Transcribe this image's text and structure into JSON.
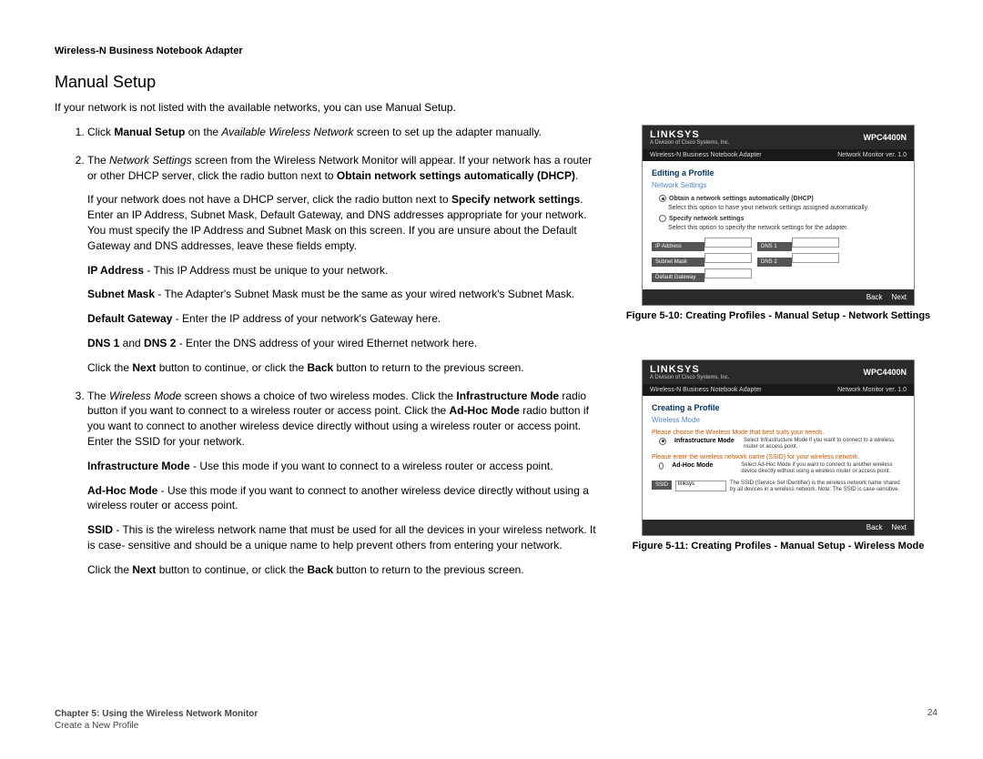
{
  "header": "Wireless-N Business Notebook Adapter",
  "title": "Manual Setup",
  "intro": "If your network is not listed with the available networks, you can use Manual Setup.",
  "steps": {
    "s1_a": "Click ",
    "s1_b": "Manual Setup",
    "s1_c": " on the ",
    "s1_d": "Available Wireless Network",
    "s1_e": " screen to set up the adapter manually.",
    "s2_a": "The ",
    "s2_b": "Network Settings",
    "s2_c": " screen from the Wireless Network Monitor will appear. If your network has a router or other DHCP server, click the radio button next to ",
    "s2_d": "Obtain network settings automatically (DHCP)",
    "s2_e": ".",
    "s2p2_a": "If your network does not have a DHCP server, click the radio button next to ",
    "s2p2_b": "Specify network settings",
    "s2p2_c": ". Enter an IP Address, Subnet Mask, Default Gateway, and DNS addresses appropriate for your network. You must specify the IP Address and Subnet Mask on this screen. If you are unsure about the Default Gateway and DNS addresses, leave these fields empty.",
    "ip_a": "IP Address",
    "ip_b": " - This IP Address must be unique to your network.",
    "sm_a": "Subnet Mask",
    "sm_b": " - The Adapter's Subnet Mask must be the same as your wired network's Subnet Mask.",
    "dg_a": "Default Gateway",
    "dg_b": " - Enter the IP address of your network's Gateway here.",
    "dns_a": "DNS 1",
    "dns_b": " and ",
    "dns_c": "DNS 2",
    "dns_d": " - Enter the DNS address of your wired Ethernet network here.",
    "nav_a": "Click the ",
    "nav_b": "Next",
    "nav_c": " button to continue, or click the ",
    "nav_d": "Back",
    "nav_e": " button to return to the previous screen.",
    "s3_a": "The ",
    "s3_b": "Wireless Mode",
    "s3_c": " screen shows a choice of two wireless modes. Click the ",
    "s3_d": "Infrastructure Mode",
    "s3_e": " radio button if you want to connect to a wireless router or access point. Click the ",
    "s3_f": "Ad-Hoc Mode",
    "s3_g": " radio button if you want to connect to another wireless device directly without using a wireless router or access point. Enter the SSID for your network.",
    "im_a": "Infrastructure Mode",
    "im_b": " - Use this mode if you want to connect to a wireless router or access point.",
    "ah_a": "Ad-Hoc Mode",
    "ah_b": " - Use this mode if you want to connect to another wireless device directly without using a wireless router or access point.",
    "ssid_a": "SSID",
    "ssid_b": " - This is the wireless network name that must be used for all the devices in your wireless network. It is case- sensitive and should be a unique name to help prevent others from entering your network."
  },
  "fig1": {
    "brand": "LINKSYS",
    "brandSub": "A Division of Cisco Systems, Inc.",
    "model": "WPC4400N",
    "barLeft": "Wireless-N Business Notebook Adapter",
    "barRight": "Network Monitor ver. 1.0",
    "h1": "Editing a Profile",
    "h2": "Network Settings",
    "opt1": "Obtain a network settings automatically (DHCP)",
    "opt1desc": "Select this option to have your network settings assigned automatically.",
    "opt2": "Specify network settings",
    "opt2desc": "Select this option to specify the network settings for the adapter.",
    "f1": "IP Address",
    "f2": "Subnet Mask",
    "f3": "Default Gateway",
    "f4": "DNS 1",
    "f5": "DNS 2",
    "back": "Back",
    "next": "Next",
    "caption": "Figure 5-10: Creating Profiles - Manual Setup - Network Settings"
  },
  "fig2": {
    "h1": "Creating a Profile",
    "h2": "Wireless Mode",
    "prompt1": "Please choose the Wireless Mode that best suits your needs.",
    "mode1": "Infrastructure Mode",
    "mode1desc": "Select Infrastructure Mode if you want to connect to a wireless router or access point.",
    "prompt2": "Please enter the wireless network name (SSID) for your wireless network.",
    "mode2": "Ad-Hoc Mode",
    "mode2desc": "Select Ad-Hoc Mode if you want to connect to another wireless device directly without using a wireless router or access point.",
    "ssidLabel": "SSID",
    "ssidVal": "linksys",
    "ssidDesc": "The SSID (Service Set IDentifier) is the wireless network name shared by all devices in a wireless network. Note: The SSID is case-sensitive.",
    "caption": "Figure 5-11: Creating Profiles - Manual Setup - Wireless Mode"
  },
  "footer": {
    "chapter": "Chapter 5: Using the Wireless Network Monitor",
    "section": "Create a New Profile",
    "page": "24"
  }
}
